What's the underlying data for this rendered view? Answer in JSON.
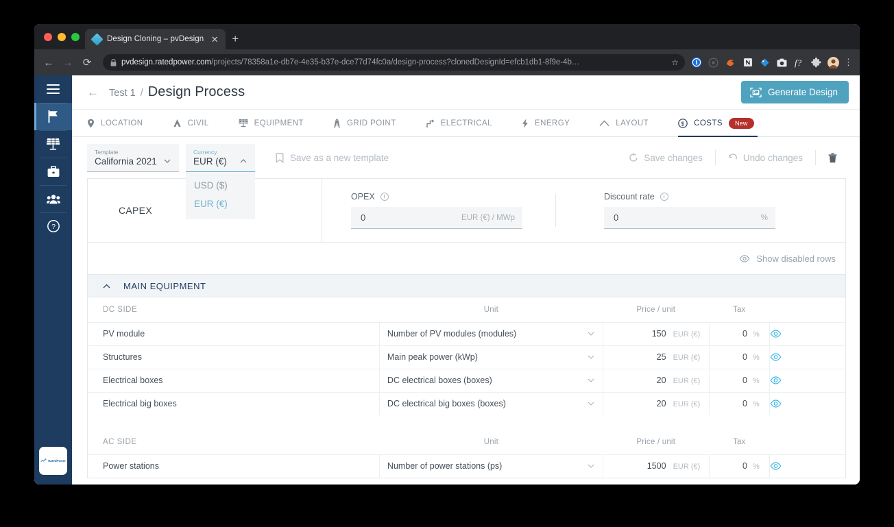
{
  "browser": {
    "tab_title": "Design Cloning – pvDesign",
    "tab_close_glyph": "✕",
    "new_tab_glyph": "+",
    "back_glyph": "←",
    "forward_glyph": "→",
    "reload_glyph": "⟳",
    "lock_glyph": "🔒",
    "url_scheme": "https://",
    "url_host": "pvdesign.ratedpower.com",
    "url_path": "/projects/78358a1e-db7e-4e35-b37e-dce77d74fc0a/design-process?clonedDesignId=efcb1db1-8f9e-4b…",
    "star_glyph": "☆",
    "menu_glyph": "⋮",
    "extensions": [
      "onepassword-icon",
      "location-icon",
      "firefox-icon",
      "notion-icon",
      "tag-icon",
      "camera-icon",
      "fontface-icon",
      "puzzle-icon",
      "avatar-icon"
    ]
  },
  "rail": {
    "items": [
      {
        "name": "menu",
        "label": "Menu"
      },
      {
        "name": "projects",
        "label": "Projects"
      },
      {
        "name": "equipment",
        "label": "Equipment"
      },
      {
        "name": "toolbox",
        "label": "Toolbox"
      },
      {
        "name": "team",
        "label": "Team"
      },
      {
        "name": "help",
        "label": "Help"
      }
    ],
    "logo_text": "RatedPower"
  },
  "header": {
    "back_glyph": "←",
    "breadcrumb_parent": "Test 1",
    "breadcrumb_separator": "/",
    "title": "Design Process",
    "generate_button": "Generate Design"
  },
  "tabs": [
    {
      "label": "LOCATION",
      "icon": "pin-icon",
      "active": false
    },
    {
      "label": "CIVIL",
      "icon": "civil-icon",
      "active": false
    },
    {
      "label": "EQUIPMENT",
      "icon": "solar-panel-icon",
      "active": false
    },
    {
      "label": "GRID POINT",
      "icon": "tower-icon",
      "active": false
    },
    {
      "label": "ELECTRICAL",
      "icon": "circuit-icon",
      "active": false
    },
    {
      "label": "ENERGY",
      "icon": "bolt-icon",
      "active": false
    },
    {
      "label": "LAYOUT",
      "icon": "layout-icon",
      "active": false
    },
    {
      "label": "COSTS",
      "icon": "dollar-coin-icon",
      "active": true,
      "badge": "New"
    }
  ],
  "toolbar": {
    "template_label": "Template",
    "template_value": "California 2021",
    "currency_label": "Currency",
    "currency_value": "EUR (€)",
    "currency_options": [
      {
        "label": "USD ($)",
        "selected": false
      },
      {
        "label": "EUR (€)",
        "selected": true
      }
    ],
    "save_template_label": "Save as a new template",
    "save_changes_label": "Save changes",
    "undo_changes_label": "Undo changes",
    "delete_label": "Delete"
  },
  "summary": {
    "capex_label": "CAPEX",
    "opex_label": "OPEX",
    "opex_value": "0",
    "opex_unit": "EUR (€) / MWp",
    "discount_label": "Discount rate",
    "discount_value": "0",
    "discount_unit": "%",
    "info_glyph": "i"
  },
  "table": {
    "show_disabled_rows_label": "Show disabled rows",
    "section_title": "MAIN EQUIPMENT",
    "columns": {
      "name": "",
      "unit": "Unit",
      "price": "Price / unit",
      "tax": "Tax"
    },
    "groups": [
      {
        "title": "DC SIDE",
        "rows": [
          {
            "name": "PV module",
            "unit": "Number of PV modules (modules)",
            "price": "150",
            "currency": "EUR (€)",
            "tax": "0",
            "pct": "%"
          },
          {
            "name": "Structures",
            "unit": "Main peak power (kWp)",
            "price": "25",
            "currency": "EUR (€)",
            "tax": "0",
            "pct": "%"
          },
          {
            "name": "Electrical boxes",
            "unit": "DC electrical boxes (boxes)",
            "price": "20",
            "currency": "EUR (€)",
            "tax": "0",
            "pct": "%"
          },
          {
            "name": "Electrical big boxes",
            "unit": "DC electrical big boxes (boxes)",
            "price": "20",
            "currency": "EUR (€)",
            "tax": "0",
            "pct": "%"
          }
        ]
      },
      {
        "title": "AC SIDE",
        "rows": [
          {
            "name": "Power stations",
            "unit": "Number of power stations (ps)",
            "price": "1500",
            "currency": "EUR (€)",
            "tax": "0",
            "pct": "%"
          }
        ]
      }
    ]
  },
  "colors": {
    "accent": "#4fa3bf",
    "rail": "#1d3c5f",
    "rail_active": "#2f5a85",
    "badge_new": "#b5302b",
    "eye_blue": "#35b4e3",
    "tab_active_underline": "#1f3a5f"
  }
}
